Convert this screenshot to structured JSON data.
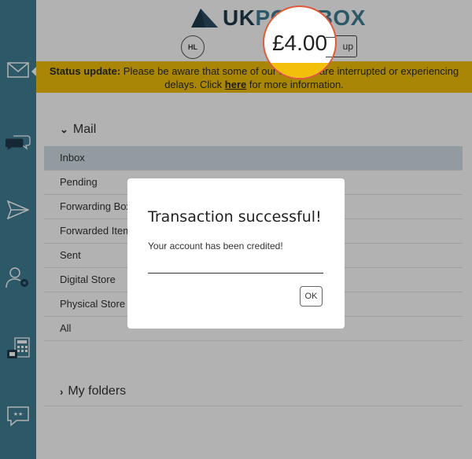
{
  "app": {
    "logo_prefix": "UK",
    "logo_suffix": "POSTBOX"
  },
  "header": {
    "avatar_initials": "HL",
    "topup_label": "up",
    "balance": "£4.00"
  },
  "banner": {
    "label": "Status update:",
    "text_before": " Please be aware that some of our services are interrupted or experiencing delays. Click ",
    "link": "here",
    "text_after": " for more information."
  },
  "mail_section": {
    "title": "Mail",
    "items": [
      {
        "label": "Inbox"
      },
      {
        "label": "Pending"
      },
      {
        "label": "Forwarding Box"
      },
      {
        "label": "Forwarded Items"
      },
      {
        "label": "Sent"
      },
      {
        "label": "Digital Store"
      },
      {
        "label": "Physical Store"
      },
      {
        "label": "All"
      }
    ]
  },
  "folders_section": {
    "title": "My folders"
  },
  "modal": {
    "title": "Transaction successful!",
    "message": "Your account has been credited!",
    "ok_label": "OK"
  },
  "colors": {
    "sidebar": "#3f7f95",
    "banner": "#f2c00a",
    "highlight_ring": "#e05a3a",
    "active_row": "#d1dfe5"
  },
  "sidebar_icons": [
    "mail-icon",
    "chat-bubbles-icon",
    "send-icon",
    "user-settings-icon",
    "calculator-icon",
    "rating-message-icon"
  ]
}
